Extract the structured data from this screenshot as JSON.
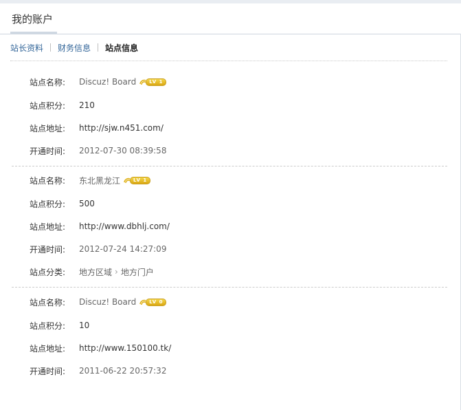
{
  "page": {
    "title": "我的账户"
  },
  "tabs": [
    {
      "label": "站长资料",
      "active": false
    },
    {
      "label": "财务信息",
      "active": false
    },
    {
      "label": "站点信息",
      "active": true
    }
  ],
  "labels": {
    "name": "站点名称:",
    "points": "站点积分:",
    "url": "站点地址:",
    "opened": "开通时间:",
    "category": "站点分类:"
  },
  "sites": [
    {
      "name": "Discuz! Board",
      "level": "LV 1",
      "points": "210",
      "url": "http://sjw.n451.com/",
      "opened": "2012-07-30 08:39:58"
    },
    {
      "name": "东北黑龙江",
      "level": "LV 1",
      "points": "500",
      "url": "http://www.dbhlj.com/",
      "opened": "2012-07-24 14:27:09",
      "category": [
        "地方区域",
        "地方门户"
      ]
    },
    {
      "name": "Discuz! Board",
      "level": "LV 0",
      "points": "10",
      "url": "http://www.150100.tk/",
      "opened": "2011-06-22 20:57:32"
    }
  ],
  "colors": {
    "link": "#336699",
    "badge": "#e0b31c",
    "header_border": "#cdd5de"
  }
}
